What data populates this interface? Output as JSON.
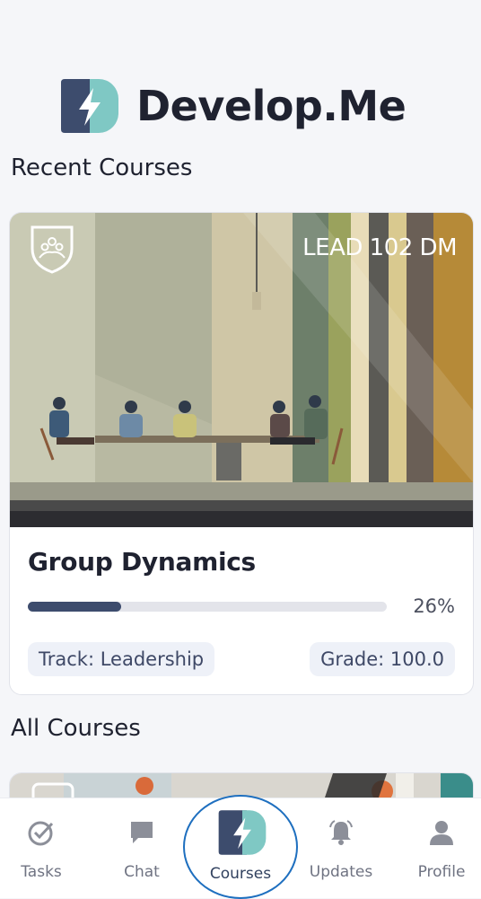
{
  "app": {
    "brand_name": "Develop.Me",
    "colors": {
      "brand_dark": "#3d4c6d",
      "brand_teal": "#7fc8c4",
      "accent_ring": "#1e6fbf"
    }
  },
  "sections": {
    "recent_title": "Recent Courses",
    "all_title": "All Courses"
  },
  "recent_course": {
    "code": "LEAD 102 DM",
    "title": "Group Dynamics",
    "progress_percent": 26,
    "progress_label": "26%",
    "track_label": "Track: Leadership",
    "grade_label": "Grade: 100.0",
    "badge_icon": "shield-people-icon"
  },
  "bottom_nav": {
    "items": [
      {
        "label": "Tasks",
        "icon": "check-circle-icon"
      },
      {
        "label": "Chat",
        "icon": "chat-bubble-icon"
      },
      {
        "label": "Courses",
        "icon": "brand-logo-icon",
        "active": true
      },
      {
        "label": "Updates",
        "icon": "bell-icon"
      },
      {
        "label": "Profile",
        "icon": "person-icon"
      }
    ]
  }
}
